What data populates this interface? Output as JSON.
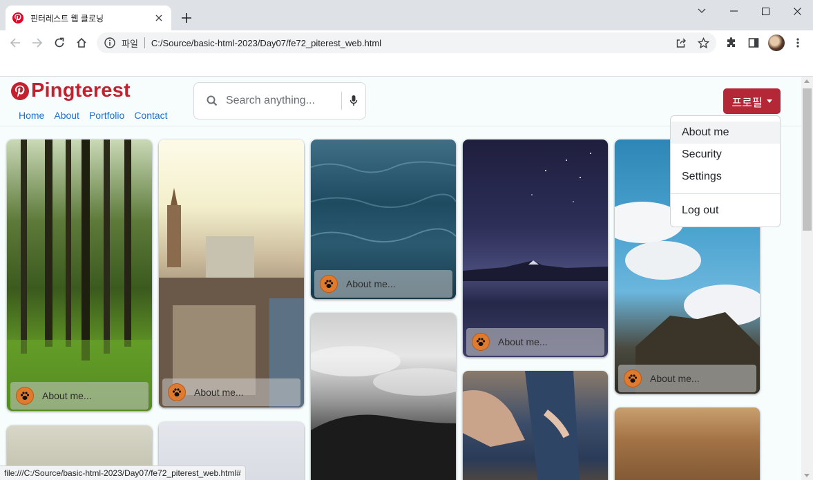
{
  "browser": {
    "tab_title": "핀터레스트 웹 클로닝",
    "url_scheme_label": "파일",
    "url": "C:/Source/basic-html-2023/Day07/fe72_piterest_web.html",
    "status_url": "file:///C:/Source/basic-html-2023/Day07/fe72_piterest_web.html#"
  },
  "site": {
    "logo_text": "Pingterest",
    "nav": [
      "Home",
      "About",
      "Portfolio",
      "Contact"
    ],
    "search_placeholder": "Search anything...",
    "profile_button": "프로필",
    "dropdown": [
      "About me",
      "Security",
      "Settings",
      "Log out"
    ]
  },
  "pins": {
    "caption": "About me...",
    "items": [
      {
        "scene": "forest",
        "has_caption": true
      },
      {
        "scene": "city",
        "has_caption": true
      },
      {
        "scene": "ocean",
        "has_caption": true
      },
      {
        "scene": "night-mountain",
        "has_caption": true
      },
      {
        "scene": "sky-rocks",
        "has_caption": true
      },
      {
        "scene": "clouds",
        "has_caption": false
      },
      {
        "scene": "jeans",
        "has_caption": false
      },
      {
        "scene": "grass",
        "has_caption": false
      },
      {
        "scene": "fog",
        "has_caption": false
      },
      {
        "scene": "haze",
        "has_caption": false
      }
    ]
  },
  "colors": {
    "brand": "#c4212f",
    "profile_button": "#b42737",
    "nav_link": "#1f6fd1",
    "page_bg": "#f7fcfd"
  }
}
